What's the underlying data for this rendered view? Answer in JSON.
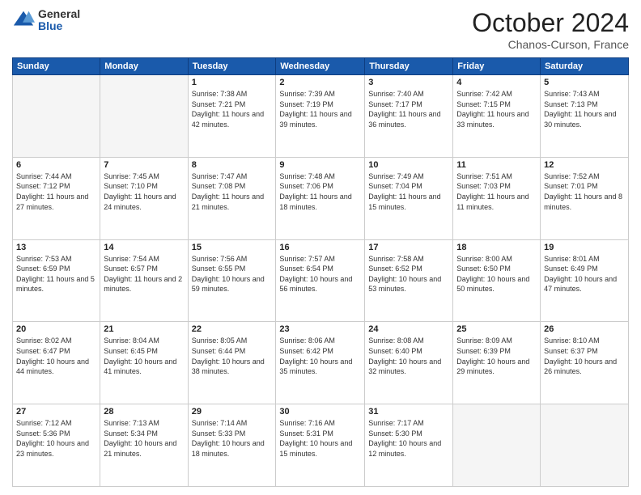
{
  "logo": {
    "general": "General",
    "blue": "Blue"
  },
  "header": {
    "month": "October 2024",
    "location": "Chanos-Curson, France"
  },
  "weekdays": [
    "Sunday",
    "Monday",
    "Tuesday",
    "Wednesday",
    "Thursday",
    "Friday",
    "Saturday"
  ],
  "weeks": [
    [
      {
        "day": "",
        "info": ""
      },
      {
        "day": "",
        "info": ""
      },
      {
        "day": "1",
        "info": "Sunrise: 7:38 AM\nSunset: 7:21 PM\nDaylight: 11 hours and 42 minutes."
      },
      {
        "day": "2",
        "info": "Sunrise: 7:39 AM\nSunset: 7:19 PM\nDaylight: 11 hours and 39 minutes."
      },
      {
        "day": "3",
        "info": "Sunrise: 7:40 AM\nSunset: 7:17 PM\nDaylight: 11 hours and 36 minutes."
      },
      {
        "day": "4",
        "info": "Sunrise: 7:42 AM\nSunset: 7:15 PM\nDaylight: 11 hours and 33 minutes."
      },
      {
        "day": "5",
        "info": "Sunrise: 7:43 AM\nSunset: 7:13 PM\nDaylight: 11 hours and 30 minutes."
      }
    ],
    [
      {
        "day": "6",
        "info": "Sunrise: 7:44 AM\nSunset: 7:12 PM\nDaylight: 11 hours and 27 minutes."
      },
      {
        "day": "7",
        "info": "Sunrise: 7:45 AM\nSunset: 7:10 PM\nDaylight: 11 hours and 24 minutes."
      },
      {
        "day": "8",
        "info": "Sunrise: 7:47 AM\nSunset: 7:08 PM\nDaylight: 11 hours and 21 minutes."
      },
      {
        "day": "9",
        "info": "Sunrise: 7:48 AM\nSunset: 7:06 PM\nDaylight: 11 hours and 18 minutes."
      },
      {
        "day": "10",
        "info": "Sunrise: 7:49 AM\nSunset: 7:04 PM\nDaylight: 11 hours and 15 minutes."
      },
      {
        "day": "11",
        "info": "Sunrise: 7:51 AM\nSunset: 7:03 PM\nDaylight: 11 hours and 11 minutes."
      },
      {
        "day": "12",
        "info": "Sunrise: 7:52 AM\nSunset: 7:01 PM\nDaylight: 11 hours and 8 minutes."
      }
    ],
    [
      {
        "day": "13",
        "info": "Sunrise: 7:53 AM\nSunset: 6:59 PM\nDaylight: 11 hours and 5 minutes."
      },
      {
        "day": "14",
        "info": "Sunrise: 7:54 AM\nSunset: 6:57 PM\nDaylight: 11 hours and 2 minutes."
      },
      {
        "day": "15",
        "info": "Sunrise: 7:56 AM\nSunset: 6:55 PM\nDaylight: 10 hours and 59 minutes."
      },
      {
        "day": "16",
        "info": "Sunrise: 7:57 AM\nSunset: 6:54 PM\nDaylight: 10 hours and 56 minutes."
      },
      {
        "day": "17",
        "info": "Sunrise: 7:58 AM\nSunset: 6:52 PM\nDaylight: 10 hours and 53 minutes."
      },
      {
        "day": "18",
        "info": "Sunrise: 8:00 AM\nSunset: 6:50 PM\nDaylight: 10 hours and 50 minutes."
      },
      {
        "day": "19",
        "info": "Sunrise: 8:01 AM\nSunset: 6:49 PM\nDaylight: 10 hours and 47 minutes."
      }
    ],
    [
      {
        "day": "20",
        "info": "Sunrise: 8:02 AM\nSunset: 6:47 PM\nDaylight: 10 hours and 44 minutes."
      },
      {
        "day": "21",
        "info": "Sunrise: 8:04 AM\nSunset: 6:45 PM\nDaylight: 10 hours and 41 minutes."
      },
      {
        "day": "22",
        "info": "Sunrise: 8:05 AM\nSunset: 6:44 PM\nDaylight: 10 hours and 38 minutes."
      },
      {
        "day": "23",
        "info": "Sunrise: 8:06 AM\nSunset: 6:42 PM\nDaylight: 10 hours and 35 minutes."
      },
      {
        "day": "24",
        "info": "Sunrise: 8:08 AM\nSunset: 6:40 PM\nDaylight: 10 hours and 32 minutes."
      },
      {
        "day": "25",
        "info": "Sunrise: 8:09 AM\nSunset: 6:39 PM\nDaylight: 10 hours and 29 minutes."
      },
      {
        "day": "26",
        "info": "Sunrise: 8:10 AM\nSunset: 6:37 PM\nDaylight: 10 hours and 26 minutes."
      }
    ],
    [
      {
        "day": "27",
        "info": "Sunrise: 7:12 AM\nSunset: 5:36 PM\nDaylight: 10 hours and 23 minutes."
      },
      {
        "day": "28",
        "info": "Sunrise: 7:13 AM\nSunset: 5:34 PM\nDaylight: 10 hours and 21 minutes."
      },
      {
        "day": "29",
        "info": "Sunrise: 7:14 AM\nSunset: 5:33 PM\nDaylight: 10 hours and 18 minutes."
      },
      {
        "day": "30",
        "info": "Sunrise: 7:16 AM\nSunset: 5:31 PM\nDaylight: 10 hours and 15 minutes."
      },
      {
        "day": "31",
        "info": "Sunrise: 7:17 AM\nSunset: 5:30 PM\nDaylight: 10 hours and 12 minutes."
      },
      {
        "day": "",
        "info": ""
      },
      {
        "day": "",
        "info": ""
      }
    ]
  ]
}
